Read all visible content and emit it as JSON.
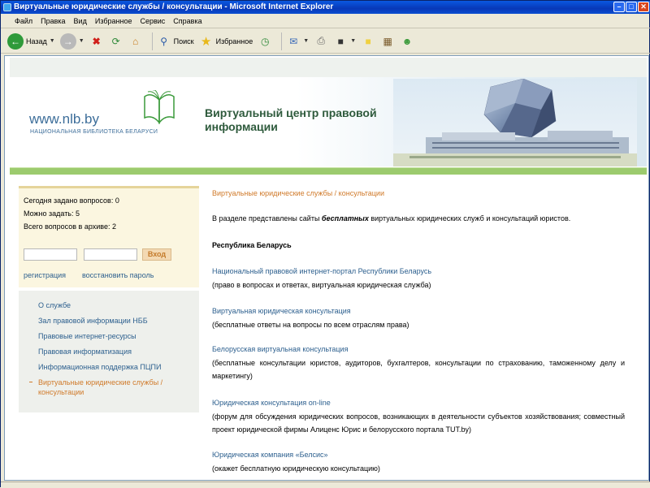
{
  "window": {
    "title": "Виртуальные юридические службы / консультации - Microsoft Internet Explorer"
  },
  "menu": [
    "Файл",
    "Правка",
    "Вид",
    "Избранное",
    "Сервис",
    "Справка"
  ],
  "toolbar": {
    "back_label": "Назад",
    "search_label": "Поиск",
    "favorites_label": "Избранное"
  },
  "header": {
    "logo_url": "www.nlb.by",
    "logo_subtitle": "НАЦИОНАЛЬНАЯ БИБЛИОТЕКА БЕЛАРУСИ",
    "site_title": "Виртуальный центр правовой информации"
  },
  "stats": {
    "asked_today": "Сегодня задано вопросов: 0",
    "can_ask": "Можно задать: 5",
    "archive_total": "Всего вопросов в архиве: 2",
    "login_button": "Вход",
    "register_link": "регистрация",
    "restore_link": "восстановить пароль"
  },
  "nav": [
    {
      "label": "О службе"
    },
    {
      "label": "Зал правовой информации НББ"
    },
    {
      "label": "Правовые интернет-ресурсы"
    },
    {
      "label": "Правовая информатизация"
    },
    {
      "label": "Информационная поддержка ПЦПИ"
    },
    {
      "label": "Виртуальные юридические службы / консультации",
      "active": true
    }
  ],
  "main": {
    "heading": "Виртуальные юридические службы / консультации",
    "intro_before": "В разделе представлены сайты ",
    "intro_em": "бесплатных",
    "intro_after": " виртуальных юридических служб и консультаций юристов.",
    "section": "Республика Беларусь",
    "items": [
      {
        "title": "Национальный правовой интернет-портал Республики Беларусь",
        "desc": "(право в вопросах и ответах, виртуальная юридическая служба)"
      },
      {
        "title": "Виртуальная юридическая консультация",
        "desc": "(бесплатные ответы на вопросы по всем отраслям права)"
      },
      {
        "title": "Белорусская виртуальная консультация",
        "desc": "(бесплатные консультации юристов, аудиторов, бухгалтеров, консультации по страхованию, таможенному делу и маркетингу)"
      },
      {
        "title": "Юридическая консультация on-line",
        "desc": "(форум для обсуждения юридических вопросов, возникающих в деятельности субъектов хозяйствования; совместный проект юридической фирмы Алиценс Юрис и белорусского портала TUT.by)"
      },
      {
        "title": "Юридическая компания «Белсис»",
        "desc": "(окажет бесплатную юридическую консультацию)"
      }
    ]
  },
  "colors": {
    "link": "#2c5f8e",
    "accent_orange": "#d07a2a",
    "green_bar": "#9ccb6e"
  }
}
